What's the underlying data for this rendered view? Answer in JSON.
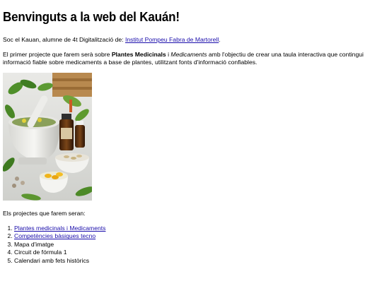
{
  "heading": "Benvinguts a la web del Kauán!",
  "intro": {
    "text": "Soc el Kauan, alumne de 4t Digitalització de: ",
    "link_label": "Institut Pompeu Fabra de Martorell",
    "after": "."
  },
  "description": {
    "part1": "El primer projecte que farem serà sobre ",
    "bold": "Plantes Medicinals",
    "part2": " i ",
    "italic": "Medicaments",
    "part3": " amb l'objectiu de crear una taula interactiva que contingui informació fiable sobre medicaments a base de plantes, utilitzant fonts d'informació confiables."
  },
  "projects": {
    "title": "Els projectes que farem seran:",
    "items": [
      {
        "label": "Plantes medicinals i Medicaments",
        "link": true
      },
      {
        "label": "Competències bàsiques tecno",
        "link": true
      },
      {
        "label": "Mapa d'imatge",
        "link": false
      },
      {
        "label": "Circuit de fórmula 1",
        "link": false
      },
      {
        "label": "Calendari amb fets històrics",
        "link": false
      }
    ]
  }
}
